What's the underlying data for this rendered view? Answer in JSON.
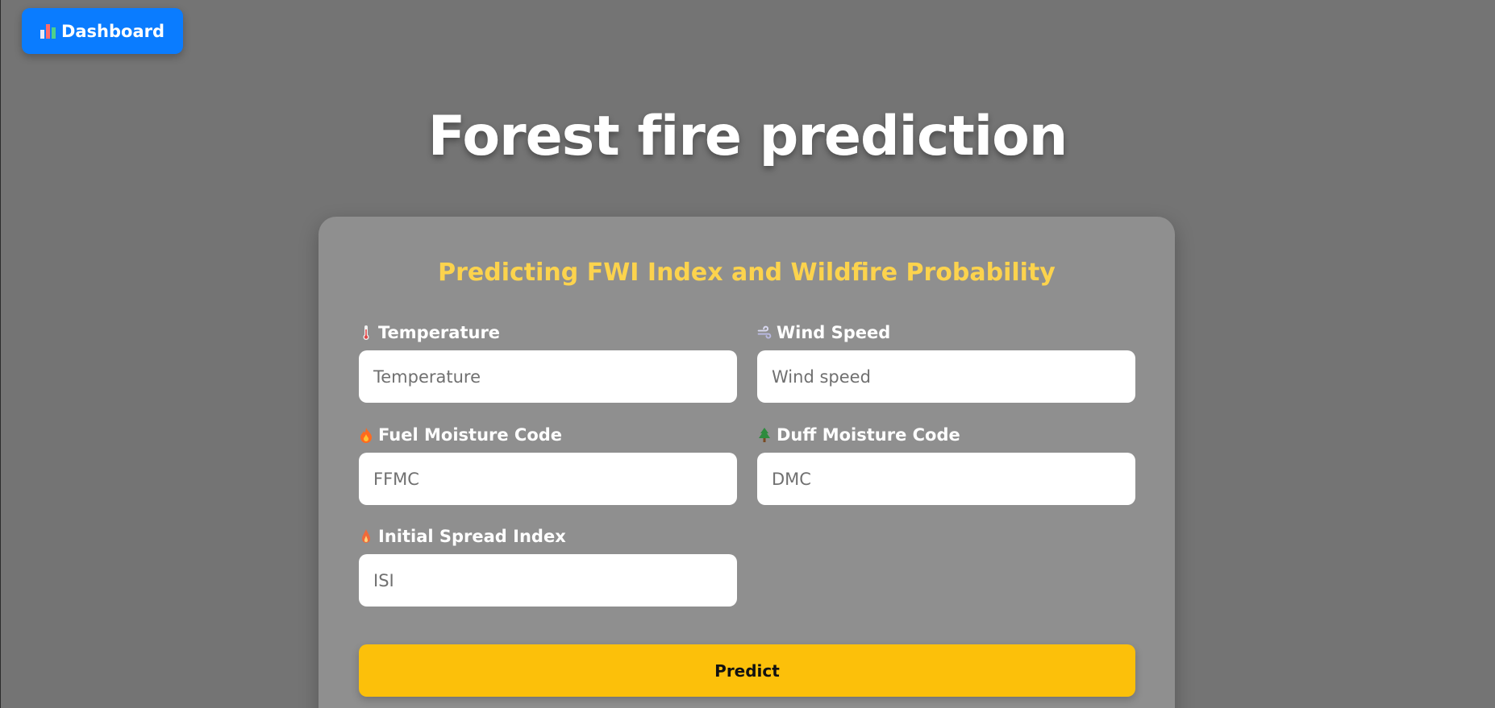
{
  "nav": {
    "dashboard_label": "Dashboard",
    "dashboard_icon": "bar-chart-icon"
  },
  "page": {
    "title": "Forest fire prediction"
  },
  "form": {
    "subtitle": "Predicting FWI Index and Wildfire Probability",
    "fields": [
      {
        "label": "Temperature",
        "placeholder": "Temperature",
        "value": "",
        "icon": "thermometer-icon"
      },
      {
        "label": "Wind Speed",
        "placeholder": "Wind speed",
        "value": "",
        "icon": "wind-icon"
      },
      {
        "label": "Fuel Moisture Code",
        "placeholder": "FFMC",
        "value": "",
        "icon": "fire-icon"
      },
      {
        "label": "Duff Moisture Code",
        "placeholder": "DMC",
        "value": "",
        "icon": "tree-icon"
      },
      {
        "label": "Initial Spread Index",
        "placeholder": "ISI",
        "value": "",
        "icon": "flame-icon"
      }
    ],
    "submit_label": "Predict"
  },
  "colors": {
    "background": "#747474",
    "card": "#8f8f8f",
    "accent_blue": "#0a7cff",
    "subtitle_yellow": "#fcd34d",
    "button_yellow": "#fcc00a"
  }
}
